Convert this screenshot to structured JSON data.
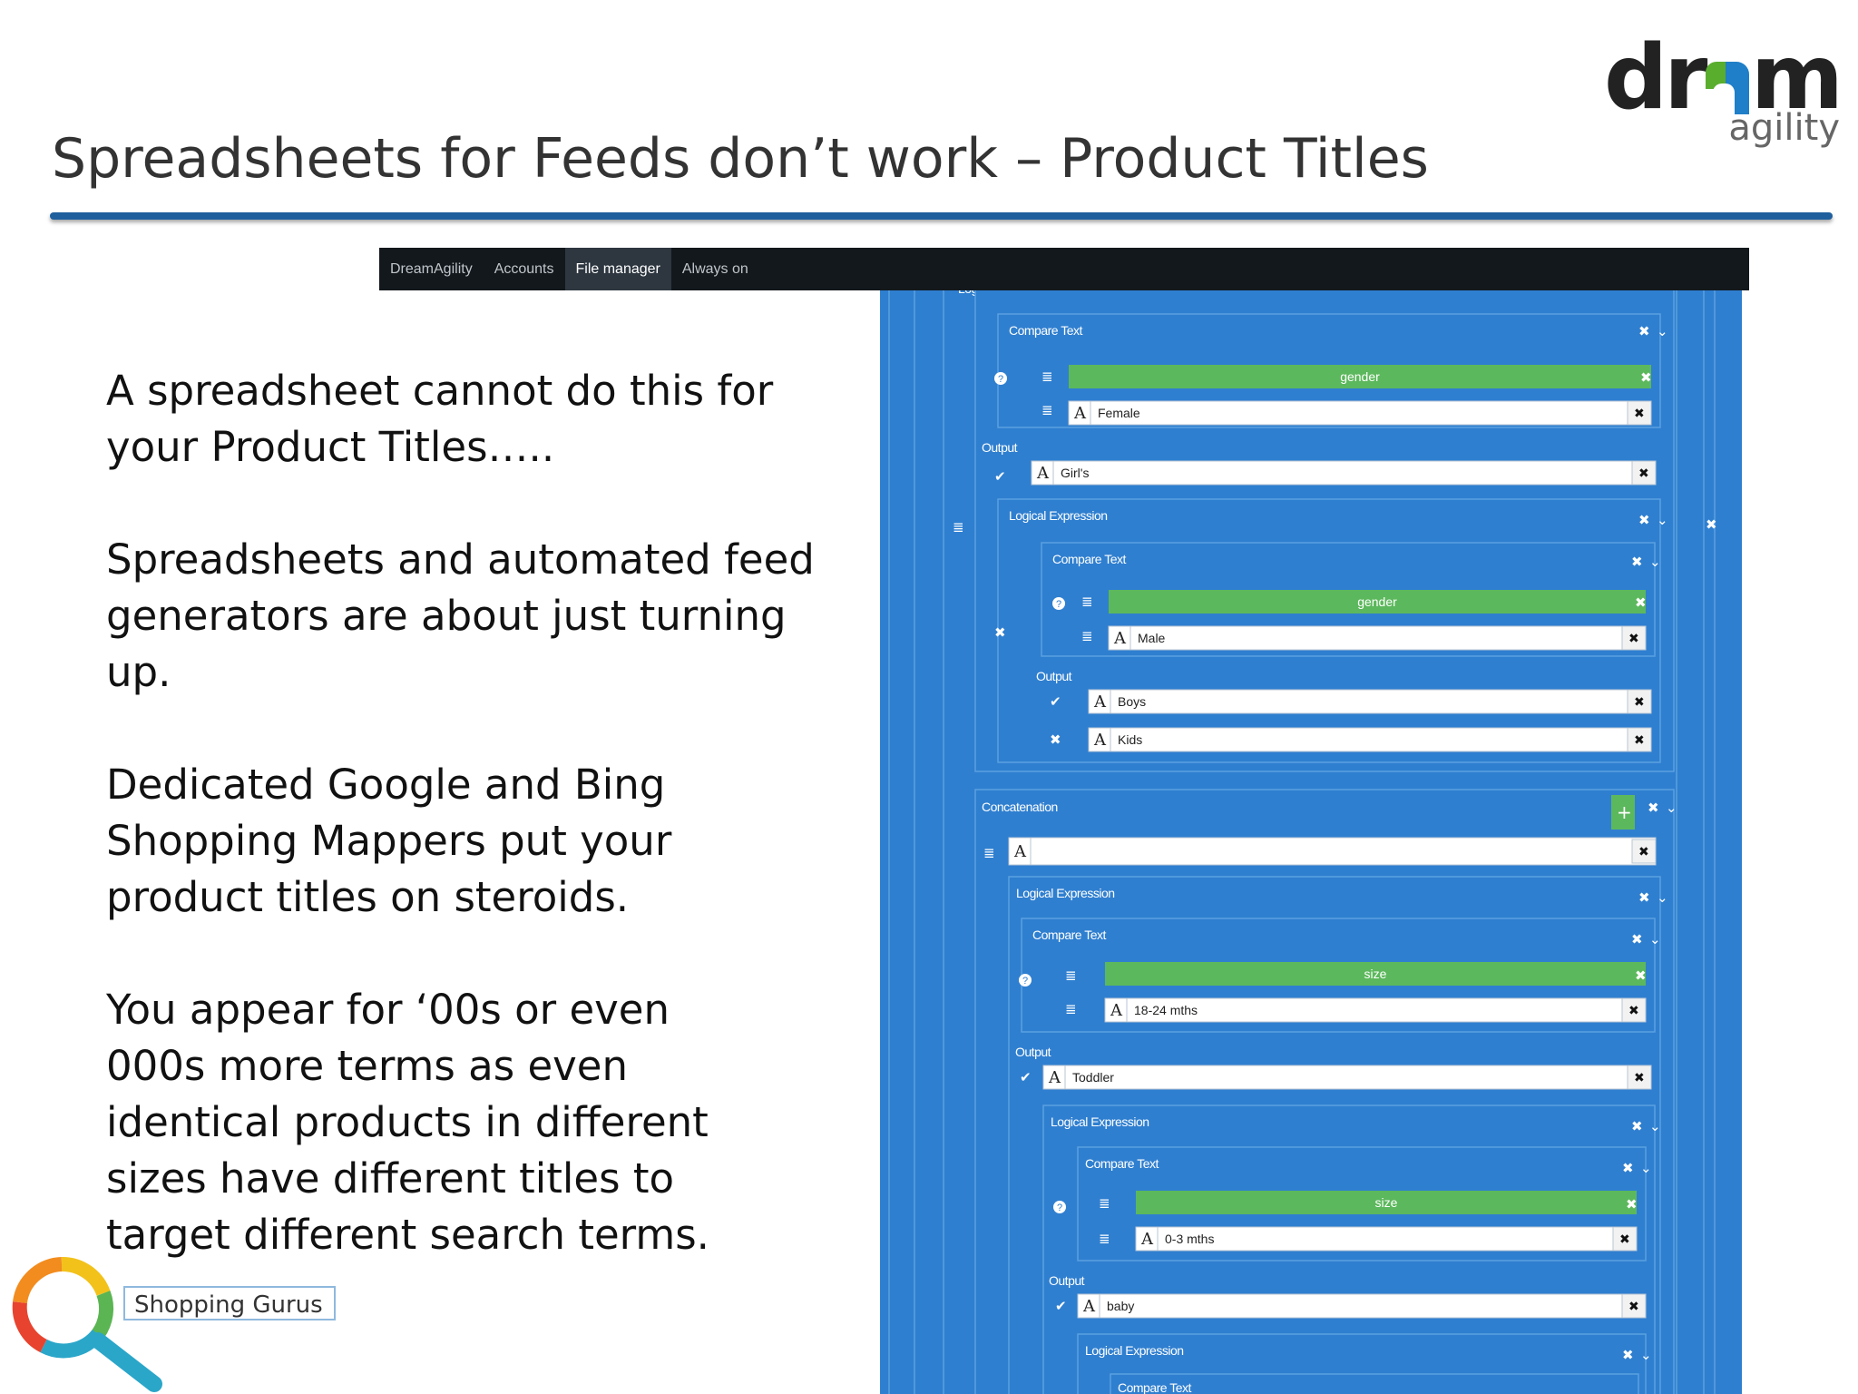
{
  "slide": {
    "title": "Spreadsheets for Feeds don’t work – Product Titles",
    "logo": {
      "word": "drᴓm",
      "word_left": "dr",
      "word_right": "m",
      "sub": "agility"
    },
    "bullets": [
      "A spreadsheet cannot do this for your Product Titles…..",
      "Spreadsheets and automated feed generators are about just turning up.",
      "Dedicated Google and Bing Shopping Mappers put your product titles on steroids.",
      "You appear for ‘00s or even 000s more terms as even identical products in different sizes have different titles to target different search terms."
    ],
    "footer_logo": "Shopping Gurus"
  },
  "app": {
    "nav": [
      "DreamAgility",
      "Accounts",
      "File manager",
      "Always on"
    ],
    "active_nav": "File manager",
    "labels": {
      "logical_expression": "Logical Expression",
      "compare_text": "Compare Text",
      "output": "Output",
      "concatenation": "Concatenation"
    },
    "values": {
      "field1": "gender",
      "text1": "Female",
      "out1": "Girl's",
      "field2": "gender",
      "text2": "Male",
      "out2a": "Boys",
      "out2b": "Kids",
      "field3": "size",
      "text3": "18-24 mths",
      "out3": "Toddler",
      "field4": "size",
      "text4": "0-3 mths",
      "out4": "baby"
    }
  },
  "colors": {
    "title_rule": "#1f5f9e",
    "panel": "#2f7fd0",
    "field_green": "#5cb85c",
    "nav_bg": "#13181d"
  }
}
